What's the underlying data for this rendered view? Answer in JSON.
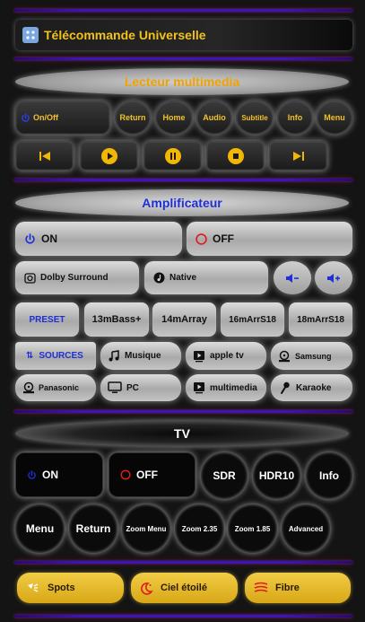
{
  "header": {
    "title": "Télécommande Universelle"
  },
  "media": {
    "title": "Lecteur multimedia",
    "onoff": "On/Off",
    "buttons": [
      "Return",
      "Home",
      "Audio",
      "Subtitle",
      "Info",
      "Menu"
    ]
  },
  "amp": {
    "title": "Amplificateur",
    "on": "ON",
    "off": "OFF",
    "dolby": "Dolby Surround",
    "native": "Native",
    "preset": "PRESET",
    "presets": [
      "13mBass+",
      "14mArray",
      "16mArrS18",
      "18mArrS18"
    ],
    "sources_label": "SOURCES",
    "sources": [
      "Musique",
      "apple tv",
      "Samsung",
      "Panasonic",
      "PC",
      "multimedia",
      "Karaoke"
    ]
  },
  "tv": {
    "title": "TV",
    "on": "ON",
    "off": "OFF",
    "row1": [
      "SDR",
      "HDR10",
      "Info"
    ],
    "row2": [
      "Menu",
      "Return",
      "Zoom Menu",
      "Zoom 2.35",
      "Zoom 1.85",
      "Advanced"
    ]
  },
  "bottom": {
    "spots": "Spots",
    "ciel": "Ciel étoilé",
    "fibre": "Fibre"
  },
  "colors": {
    "accent_gold": "#f2b705",
    "accent_blue": "#1f2fd6",
    "divider": "#3a16b5",
    "off_red": "#e01b1b"
  }
}
